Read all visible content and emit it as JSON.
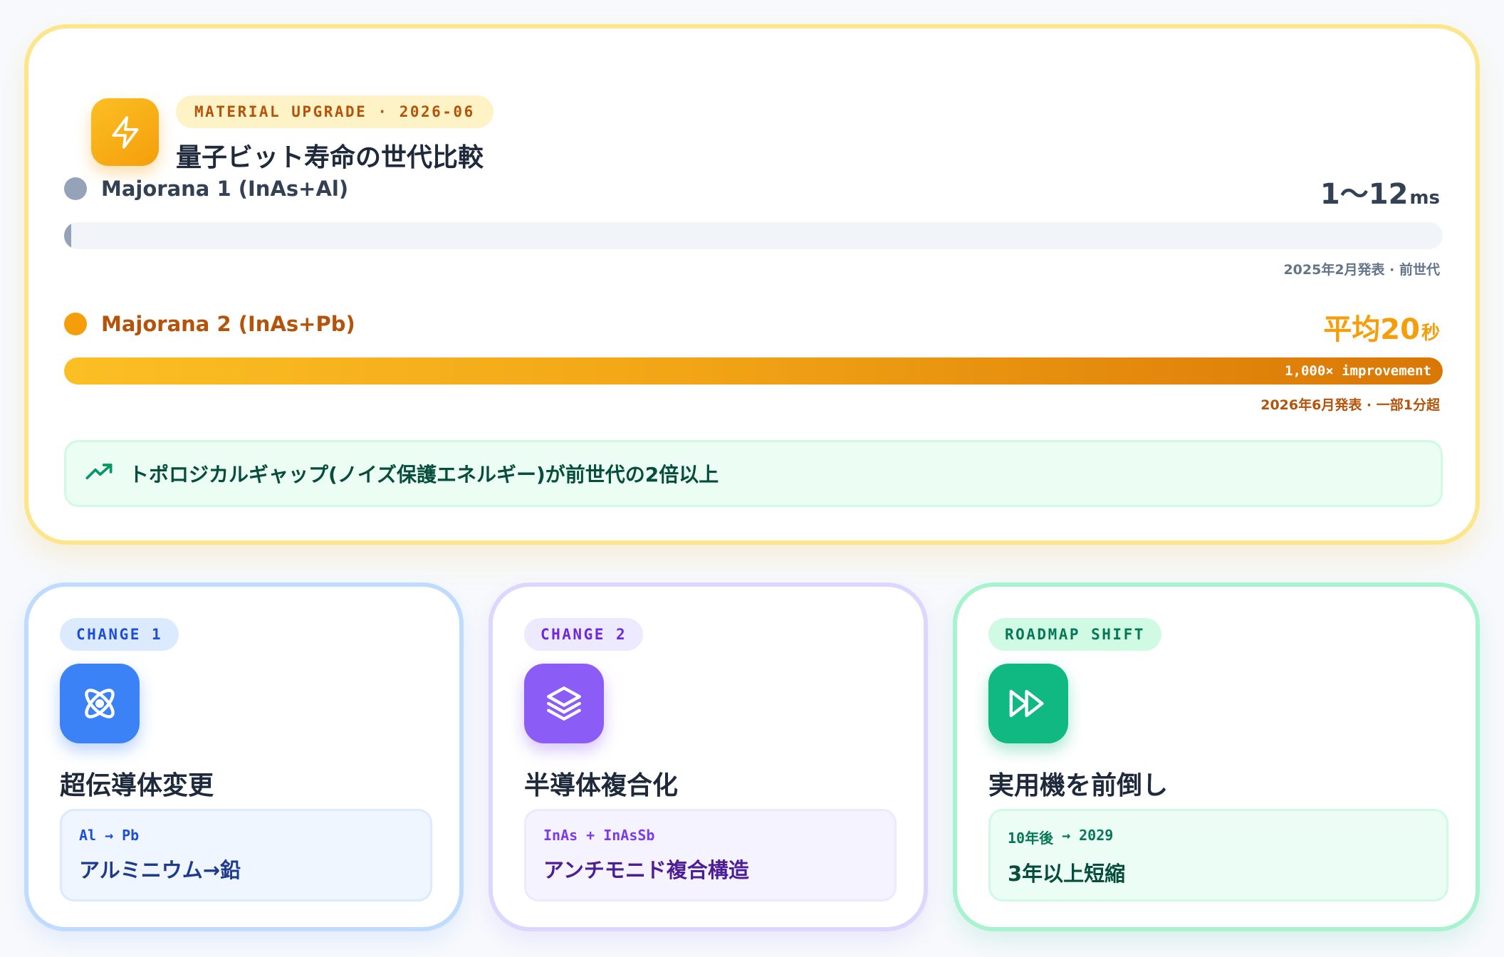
{
  "hero": {
    "tag": "MATERIAL UPGRADE · 2026-06",
    "title": "量子ビット寿命の世代比較",
    "icon": "lightning-bolt-icon",
    "accent": "#f59e0b"
  },
  "comparison": [
    {
      "name": "Majorana 1 (InAs+Al)",
      "value": "1〜12",
      "unit": "ms",
      "fill_fraction": 0.005,
      "note": "2025年2月発表 · 前世代",
      "color": "#94a3b8"
    },
    {
      "name": "Majorana 2 (InAs+Pb)",
      "value": "平均20",
      "unit": "秒",
      "fill_fraction": 1.0,
      "bar_label": "1,000× improvement",
      "note": "2026年6月発表 · 一部1分超",
      "color": "#f59e0b"
    }
  ],
  "callout": {
    "icon": "trending-up-icon",
    "text": "トポロジカルギャップ(ノイズ保護エネルギー)が前世代の2倍以上"
  },
  "cards": [
    {
      "tag": "CHANGE 1",
      "icon": "atom-icon",
      "title": "超伝導体変更",
      "from": "Al",
      "arrow": "→",
      "to": "Pb",
      "description": "アルミニウム→鉛",
      "accent": "#3b82f6"
    },
    {
      "tag": "CHANGE 2",
      "icon": "layers-icon",
      "title": "半導体複合化",
      "from": "InAs",
      "arrow": "+",
      "to": "InAsSb",
      "description": "アンチモニド複合構造",
      "accent": "#8b5cf6"
    },
    {
      "tag": "ROADMAP SHIFT",
      "icon": "fast-forward-icon",
      "title": "実用機を前倒し",
      "from": "10年後",
      "arrow": "→",
      "to": "2029",
      "description": "3年以上短縮",
      "accent": "#10b981"
    }
  ]
}
